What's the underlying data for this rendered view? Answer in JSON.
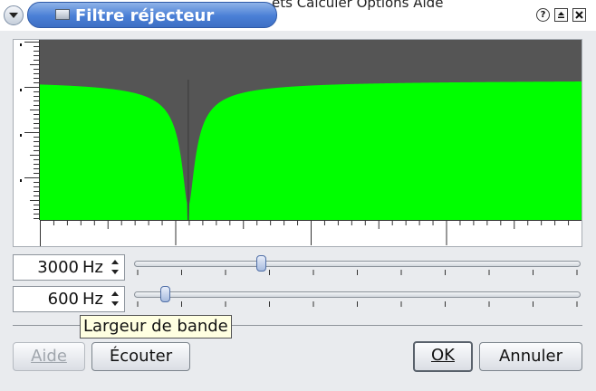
{
  "window": {
    "title": "Filtre réjecteur",
    "background_menu_text": "ets  Calculer  Options  Aide"
  },
  "plot": {
    "colors": {
      "fill": "#00ff00",
      "background": "#555555",
      "frame": "#ffffff"
    },
    "notch": {
      "center_fraction": 0.274,
      "depth_fraction": 0.9
    }
  },
  "frequency": {
    "value": "3000",
    "unit": "Hz",
    "slider_fraction": 0.274
  },
  "bandwidth": {
    "value": "600",
    "unit": "Hz",
    "slider_fraction": 0.058
  },
  "tooltip": {
    "text": "Largeur de bande"
  },
  "buttons": {
    "help": {
      "label": "Aide",
      "enabled": false
    },
    "listen": {
      "label": "Écouter",
      "enabled": true
    },
    "ok": {
      "label": "OK",
      "enabled": true,
      "default": true
    },
    "cancel": {
      "label": "Annuler",
      "enabled": true
    }
  },
  "icons": {
    "menu": "chevron-down-icon",
    "app": "window-icon",
    "help": "question-icon",
    "shade": "shade-icon",
    "close": "close-icon"
  }
}
